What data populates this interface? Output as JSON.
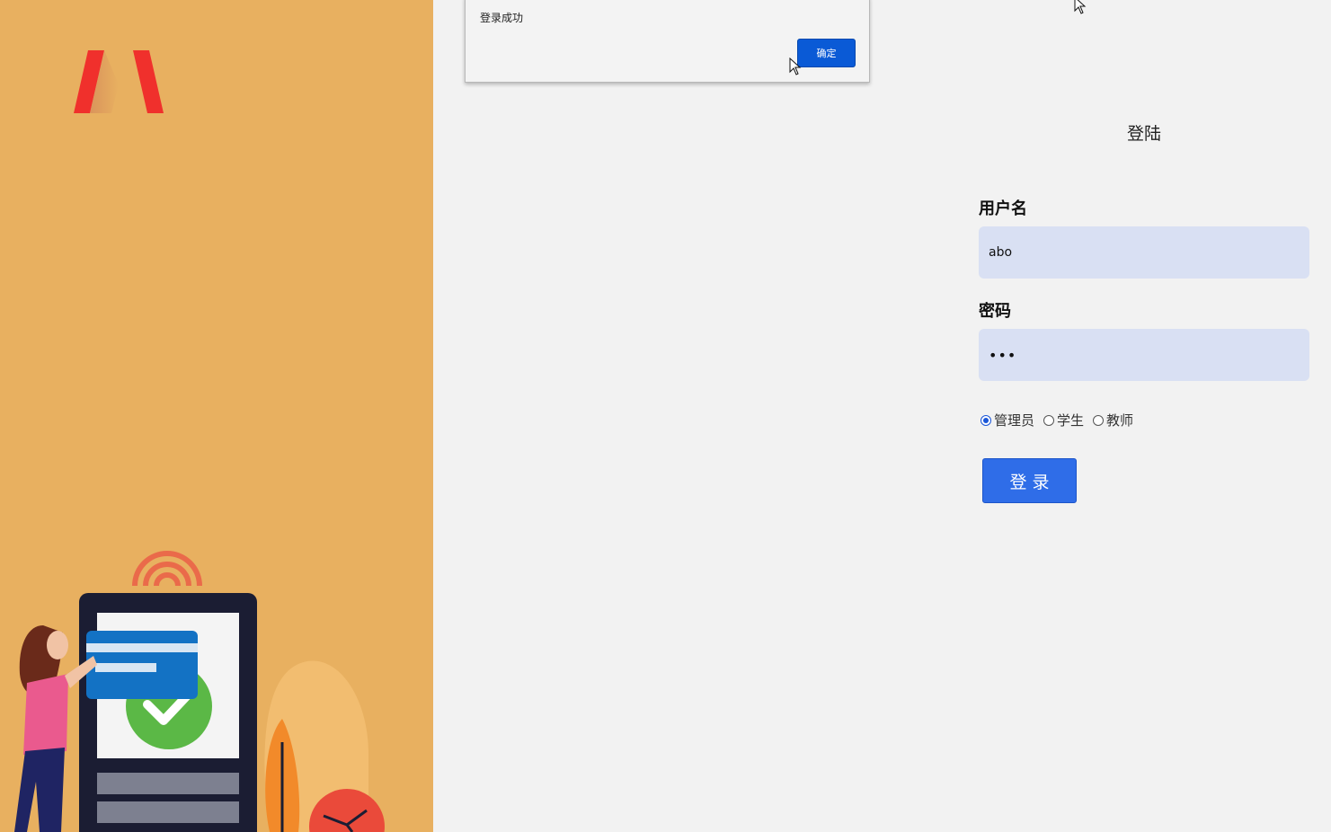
{
  "alert": {
    "message": "登录成功",
    "ok_label": "确定"
  },
  "login": {
    "title": "登陆",
    "username_label": "用户名",
    "username_value": "abo",
    "password_label": "密码",
    "password_value": "•••",
    "roles": [
      {
        "label": "管理员",
        "checked": true
      },
      {
        "label": "学生",
        "checked": false
      },
      {
        "label": "教师",
        "checked": false
      }
    ],
    "submit_label": "登录"
  },
  "colors": {
    "left_panel": "#e8b060",
    "background": "#f2f2f2",
    "input_bg": "#d9e0f3",
    "primary_button": "#2f6de8",
    "logo_red": "#f0302c"
  },
  "icons": [
    "logo-icon",
    "mouse-cursor-icon",
    "radio-icon"
  ]
}
